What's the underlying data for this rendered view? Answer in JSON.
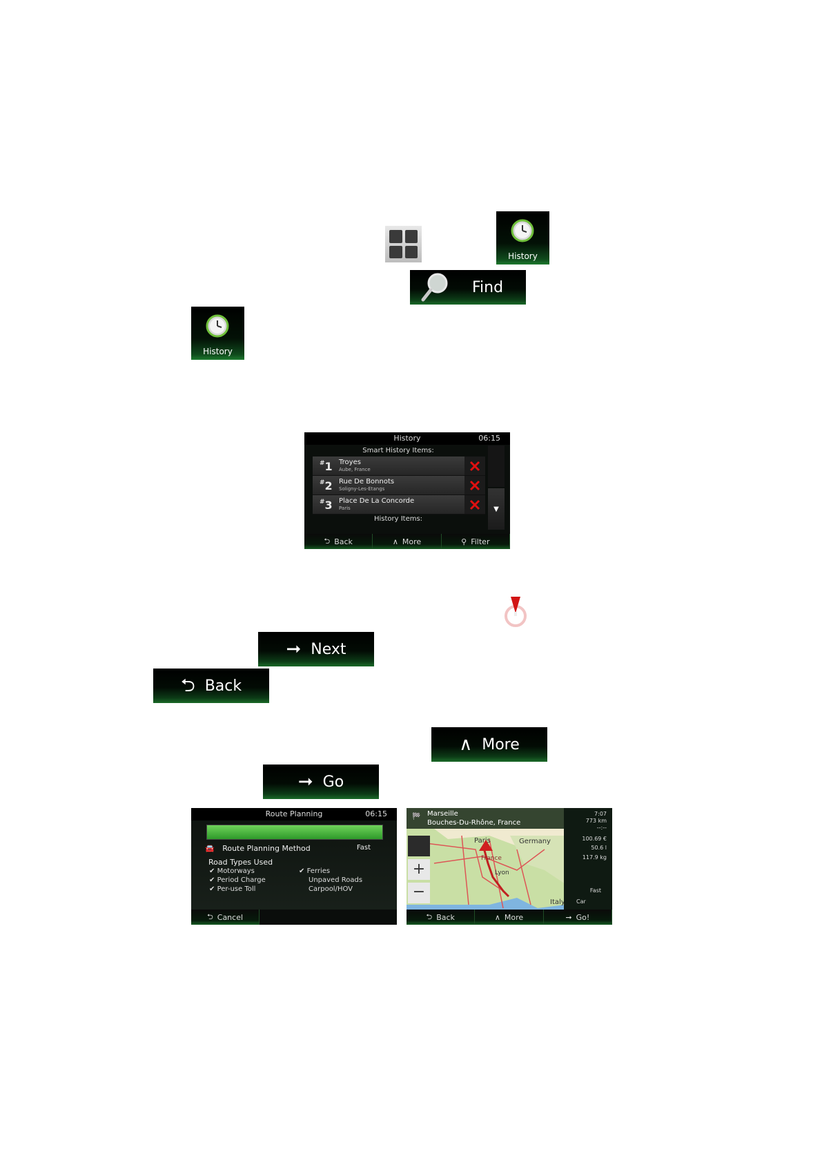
{
  "buttons": {
    "history_tile_label": "History",
    "find_label": "Find",
    "next_label": "Next",
    "back_label": "Back",
    "more_label": "More",
    "go_label": "Go"
  },
  "history_screen": {
    "title": "History",
    "time": "06:15",
    "section1": "Smart History Items:",
    "items": [
      {
        "num": "1",
        "name": "Troyes",
        "sub": "Aube, France"
      },
      {
        "num": "2",
        "name": "Rue De Bonnots",
        "sub": "Soligny-Les-Etangs"
      },
      {
        "num": "3",
        "name": "Place De La Concorde",
        "sub": "Paris"
      }
    ],
    "section2": "History Items:",
    "bottom": {
      "back": "Back",
      "more": "More",
      "filter": "Filter"
    }
  },
  "route_screen": {
    "title": "Route Planning",
    "time": "06:15",
    "method_label": "Route Planning Method",
    "method_value": "Fast",
    "road_types_title": "Road Types Used",
    "left_list": [
      "Motorways",
      "Period Charge",
      "Per-use Toll"
    ],
    "right_list": [
      "Ferries",
      "Unpaved Roads",
      "Carpool/HOV"
    ],
    "right_checked": [
      true,
      false,
      false
    ],
    "cancel": "Cancel"
  },
  "map_screen": {
    "dest_name": "Marseille",
    "dest_region": "Bouches-Du-Rhône, France",
    "labels": {
      "paris": "Paris",
      "germany": "Germany",
      "france": "France",
      "lyon": "Lyon",
      "italy": "Italy"
    },
    "stats": {
      "time": "7:07",
      "dist": "773 km",
      "eta": "--:--",
      "cost": "100.69 €",
      "fuel": "50.6 l",
      "co2": "117.9 kg",
      "mode": "Fast",
      "vehicle": "Car"
    },
    "bottom": {
      "back": "Back",
      "more": "More",
      "go": "Go!"
    }
  },
  "colors": {
    "accent_green": "#1d7a2e",
    "delete_red": "#e01010"
  }
}
